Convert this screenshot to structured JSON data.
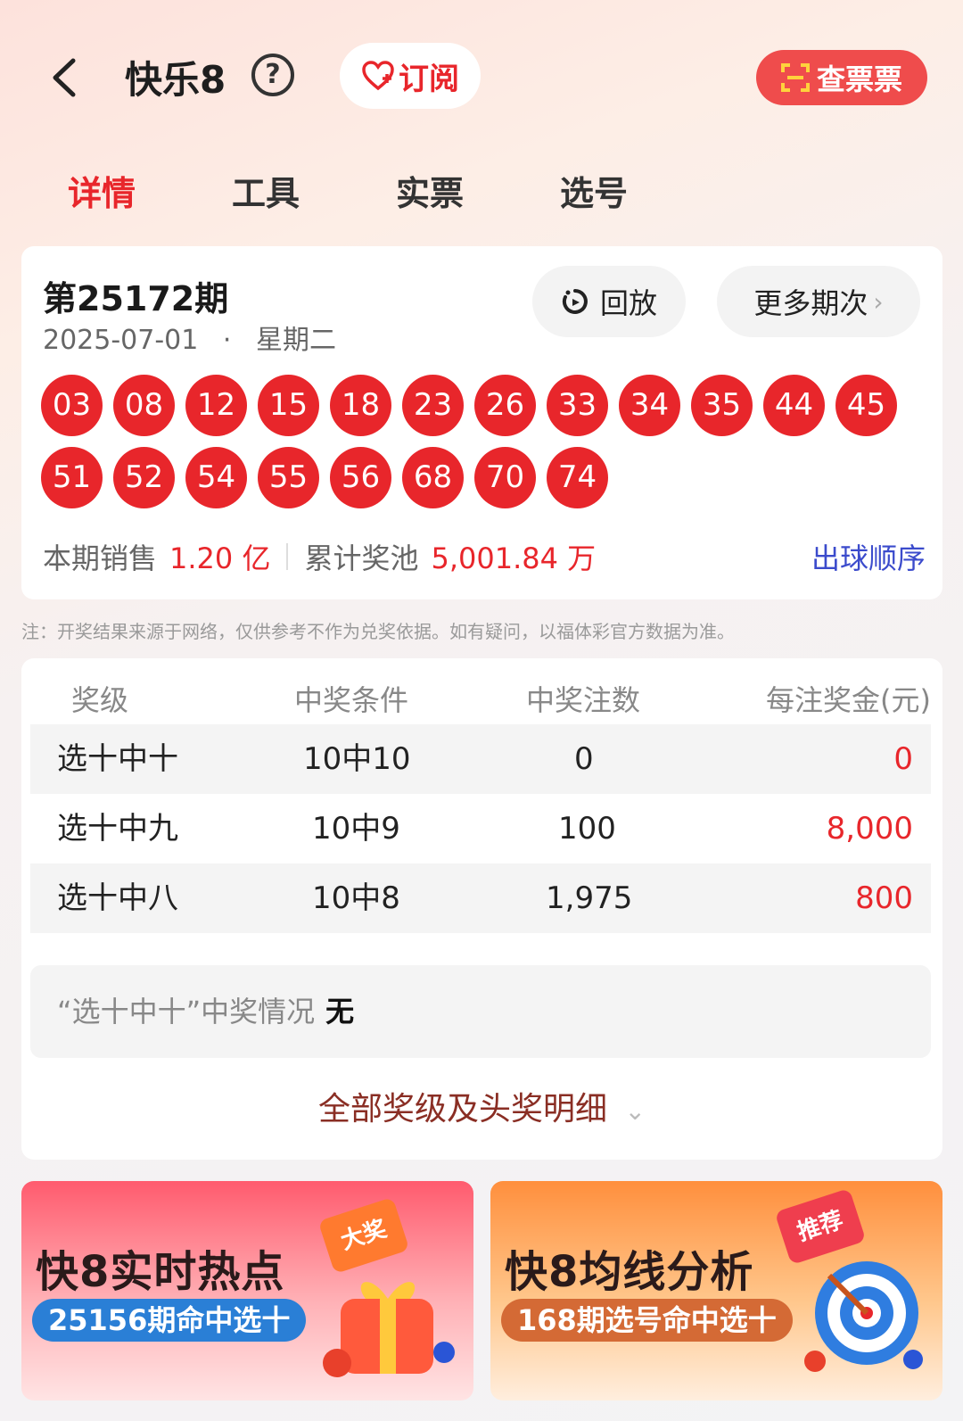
{
  "header": {
    "title": "快乐8",
    "help_symbol": "?",
    "subscribe_label": "订阅",
    "check_ticket_label": "查票票"
  },
  "tabs": [
    {
      "label": "详情",
      "active": true
    },
    {
      "label": "工具",
      "active": false
    },
    {
      "label": "实票",
      "active": false
    },
    {
      "label": "选号",
      "active": false
    }
  ],
  "draw": {
    "issue": "第25172期",
    "date": "2025-07-01",
    "weekday": "星期二",
    "replay_label": "回放",
    "more_issues_label": "更多期次",
    "numbers": [
      "03",
      "08",
      "12",
      "15",
      "18",
      "23",
      "26",
      "33",
      "34",
      "35",
      "44",
      "45",
      "51",
      "52",
      "54",
      "55",
      "56",
      "68",
      "70",
      "74"
    ],
    "sales_label": "本期销售",
    "sales_value": "1.20 亿",
    "pool_label": "累计奖池",
    "pool_value": "5,001.84 万",
    "order_link": "出球顺序"
  },
  "note": "注：开奖结果来源于网络，仅供参考不作为兑奖依据。如有疑问，以福体彩官方数据为准。",
  "prize_table": {
    "headers": [
      "奖级",
      "中奖条件",
      "中奖注数",
      "每注奖金(元)"
    ],
    "rows": [
      {
        "level": "选十中十",
        "condition": "10中10",
        "count": "0",
        "amount": "0"
      },
      {
        "level": "选十中九",
        "condition": "10中9",
        "count": "100",
        "amount": "8,000"
      },
      {
        "level": "选十中八",
        "condition": "10中8",
        "count": "1,975",
        "amount": "800"
      }
    ],
    "winner_label": "“选十中十”中奖情况",
    "winner_value": "无",
    "all_levels_label": "全部奖级及头奖明细"
  },
  "banners": [
    {
      "title": "快8实时热点",
      "subtitle": "25156期命中选十",
      "stamp": "大奖"
    },
    {
      "title": "快8均线分析",
      "subtitle": "168期选号命中选十",
      "stamp": "推荐"
    }
  ],
  "colors": {
    "accent": "#e8262b",
    "link": "#3b4bcc"
  }
}
